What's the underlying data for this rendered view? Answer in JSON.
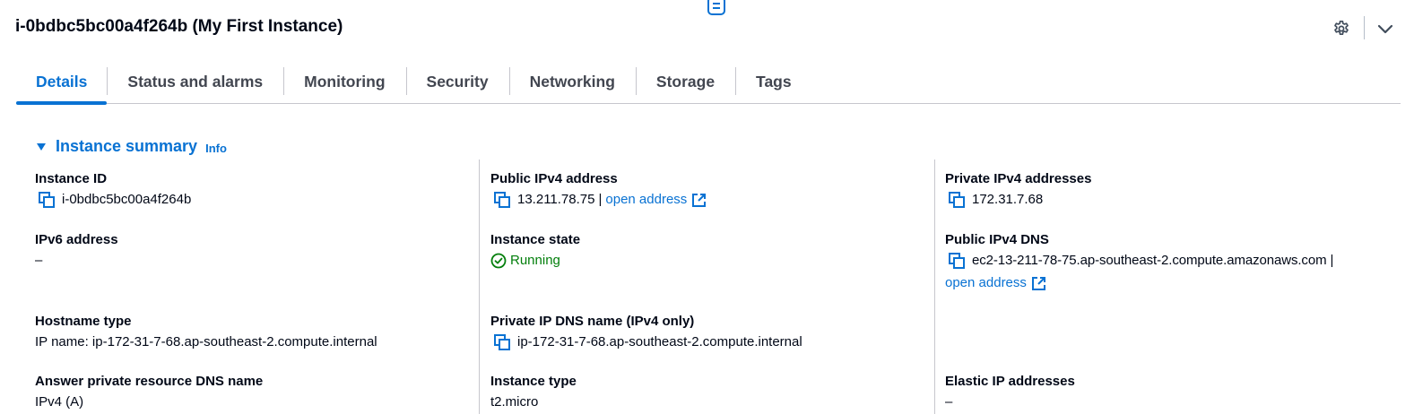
{
  "header": {
    "title": "i-0bdbc5bc00a4f264b (My First Instance)"
  },
  "tabs": [
    {
      "label": "Details",
      "active": true
    },
    {
      "label": "Status and alarms",
      "active": false
    },
    {
      "label": "Monitoring",
      "active": false
    },
    {
      "label": "Security",
      "active": false
    },
    {
      "label": "Networking",
      "active": false
    },
    {
      "label": "Storage",
      "active": false
    },
    {
      "label": "Tags",
      "active": false
    }
  ],
  "summary": {
    "heading": "Instance summary",
    "info": "Info"
  },
  "fields": {
    "instance_id": {
      "label": "Instance ID",
      "value": "i-0bdbc5bc00a4f264b"
    },
    "public_ipv4": {
      "label": "Public IPv4 address",
      "value": "13.211.78.75",
      "separator": "|",
      "link": "open address"
    },
    "private_ipv4": {
      "label": "Private IPv4 addresses",
      "value": "172.31.7.68"
    },
    "ipv6": {
      "label": "IPv6 address",
      "value": "–"
    },
    "instance_state": {
      "label": "Instance state",
      "value": "Running"
    },
    "public_dns": {
      "label": "Public IPv4 DNS",
      "value": "ec2-13-211-78-75.ap-southeast-2.compute.amazonaws.com",
      "separator": "|",
      "link": "open address"
    },
    "hostname_type": {
      "label": "Hostname type",
      "value": "IP name: ip-172-31-7-68.ap-southeast-2.compute.internal"
    },
    "private_dns": {
      "label": "Private IP DNS name (IPv4 only)",
      "value": "ip-172-31-7-68.ap-southeast-2.compute.internal"
    },
    "answer_dns": {
      "label": "Answer private resource DNS name",
      "value": "IPv4 (A)"
    },
    "instance_type": {
      "label": "Instance type",
      "value": "t2.micro"
    },
    "elastic_ip": {
      "label": "Elastic IP addresses",
      "value": "–"
    }
  },
  "colors": {
    "accent": "#0972d3",
    "success": "#037f0c",
    "text": "#000716",
    "tab_inactive": "#424650",
    "divider": "#c6c6cd"
  },
  "icons": [
    "drag-handle-icon",
    "gear-icon",
    "chevron-down-icon",
    "caret-down-icon",
    "copy-icon",
    "external-link-icon",
    "status-positive-icon"
  ]
}
